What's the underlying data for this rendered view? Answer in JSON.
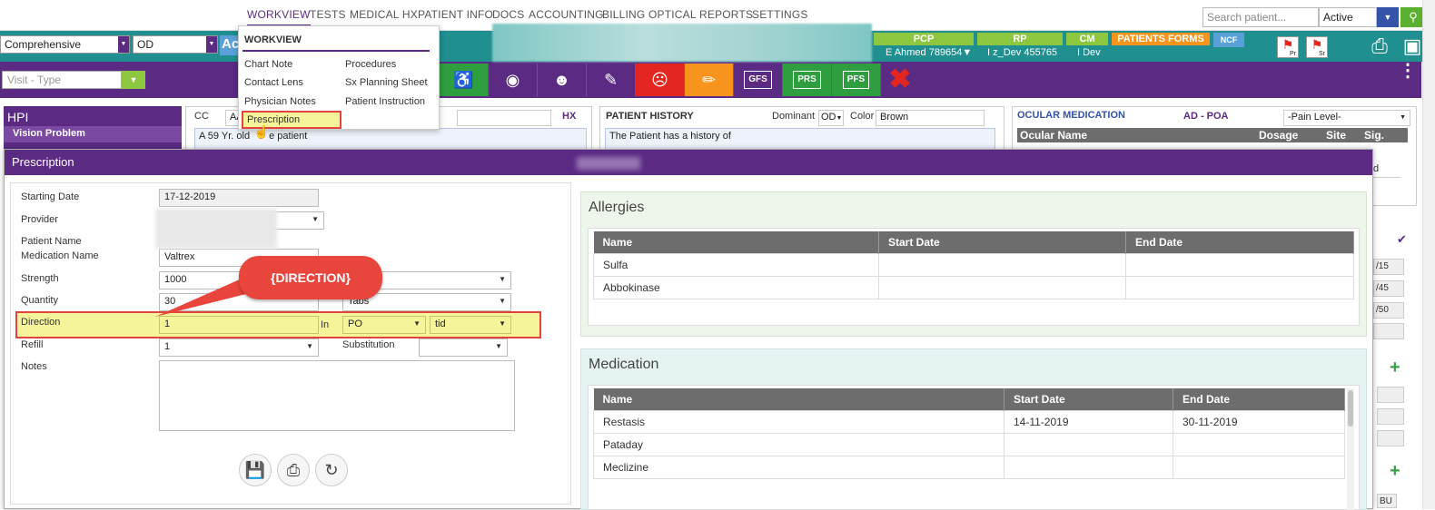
{
  "nav": {
    "items": [
      "WORKVIEW",
      "TESTS",
      "MEDICAL HX",
      "PATIENT INFO",
      "DOCS",
      "ACCOUNTING",
      "BILLING",
      "OPTICAL",
      "REPORTS",
      "SETTINGS"
    ],
    "search_placeholder": "Search patient...",
    "status_value": "Active"
  },
  "tealbar": {
    "exam_type": "Comprehensive",
    "eye": "OD",
    "ac_label": "Ac",
    "pcp_label": "PCP",
    "pcp_value": "E Ahmed 789654▼",
    "rp_label": "RP",
    "rp_value": "I z_Dev 455765",
    "cm_label": "CM",
    "cm_value": "I Dev",
    "patients_forms": "PATIENTS FORMS",
    "ncf": "NCF",
    "flag_pr": "Pr",
    "flag_sr": "Sr"
  },
  "toolbar": {
    "visit_type_placeholder": "Visit - Type",
    "gfs": "GFS",
    "prs": "PRS",
    "pfs": "PFS"
  },
  "menu": {
    "title": "WORKVIEW",
    "col1": [
      "Chart Note",
      "Contact Lens",
      "Physician Notes",
      "Prescription"
    ],
    "col2": [
      "Procedures",
      "Sx Planning Sheet",
      "Patient Instruction"
    ]
  },
  "background": {
    "hpi_title": "HPI",
    "hpi_sub": "Vision Problem",
    "cc_label": "CC",
    "cc_prefix": "AA",
    "cc_text": "A 59 Yr. old ",
    "cc_text_end": "e patient",
    "hx_label": "HX",
    "patient_history_title": "PATIENT HISTORY",
    "dominant_label": "Dominant",
    "dominant_value": "OD",
    "color_label": "Color",
    "color_value": "Brown",
    "history_text": "The Patient has a history of",
    "ocular_med_title": "OCULAR MEDICATION",
    "ad_poa": "AD - POA",
    "pain_level": "-Pain Level-",
    "ocular_cols": [
      "Ocular Name",
      "Dosage",
      "Site",
      "Sig."
    ],
    "right_vals": [
      "d",
      "/15",
      "/45",
      "/50",
      "BU"
    ]
  },
  "prescription": {
    "title": "Prescription",
    "labels": {
      "starting_date": "Starting Date",
      "provider": "Provider",
      "patient_name": "Patient Name",
      "medication_name": "Medication Name",
      "strength": "Strength",
      "quantity": "Quantity",
      "direction": "Direction",
      "refill": "Refill",
      "substitution": "Substitution",
      "notes": "Notes",
      "in": "In"
    },
    "values": {
      "starting_date": "17-12-2019",
      "medication_name": "Valtrex",
      "strength": "1000",
      "quantity": "30",
      "quantity_unit": "Tabs",
      "direction": "1",
      "route": "PO",
      "frequency": "tid",
      "refill": "1",
      "substitution": ""
    },
    "callout": "{DIRECTION}"
  },
  "allergies": {
    "title": "Allergies",
    "columns": [
      "Name",
      "Start Date",
      "End Date"
    ],
    "rows": [
      [
        "Sulfa",
        "",
        ""
      ],
      [
        "Abbokinase",
        "",
        ""
      ]
    ]
  },
  "medication": {
    "title": "Medication",
    "columns": [
      "Name",
      "Start Date",
      "End Date"
    ],
    "rows": [
      [
        "Restasis",
        "14-11-2019",
        "30-11-2019"
      ],
      [
        "Pataday",
        "",
        ""
      ],
      [
        "Meclizine",
        "",
        ""
      ]
    ]
  },
  "colors": {
    "purple": "#5b2b84",
    "teal": "#1f8f8f",
    "highlight": "#f6f49a",
    "callout_red": "#e8453d"
  }
}
